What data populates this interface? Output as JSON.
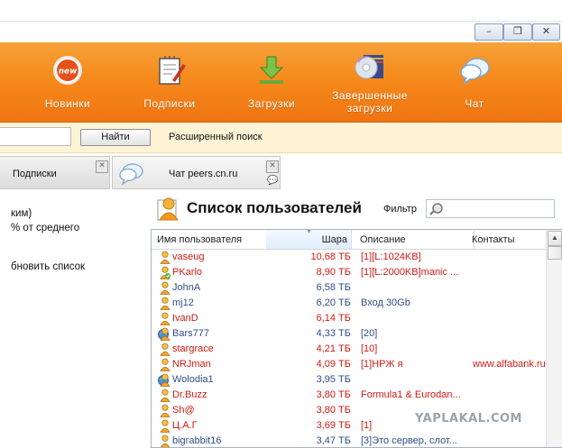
{
  "window": {
    "minimize": "–",
    "restore": "❐",
    "close": "✕"
  },
  "toolbar": {
    "items": [
      {
        "label": "Новинки",
        "icon": "new-badge-icon"
      },
      {
        "label": "Подписки",
        "icon": "subscriptions-notepad-icon"
      },
      {
        "label": "Загрузки",
        "icon": "download-arrow-icon"
      },
      {
        "label1": "Завершенные",
        "label2": "загрузки",
        "icon": "completed-downloads-disc-icon"
      },
      {
        "label": "Чат",
        "icon": "chat-bubbles-icon"
      }
    ],
    "colors": {
      "top": "#f7a23a",
      "bottom": "#ef7412"
    }
  },
  "search": {
    "value": "",
    "button": "Найти",
    "advanced": "Расширенный поиск"
  },
  "tabs": [
    {
      "label": "Подписки"
    },
    {
      "label": "Чат peers.cn.ru"
    }
  ],
  "left": {
    "line1": "ким)",
    "line2": "% от среднего",
    "line3": "бновить список"
  },
  "userlist": {
    "title": "Список пользователей",
    "filter_label": "Фильтр",
    "filter_value": "",
    "columns": [
      "Имя пользователя",
      "Шара",
      "Описание",
      "Контакты"
    ],
    "rows": [
      {
        "name": "vaseug",
        "share": "10,68 ТБ",
        "desc": "[1][L:1024KB]",
        "contact": "",
        "color": "red",
        "icon": "user-icon"
      },
      {
        "name": "PKarlo",
        "share": "8,90 ТБ",
        "desc": "[1][L:2000KB]manic ...",
        "contact": "",
        "color": "red",
        "icon": "user-ok-icon"
      },
      {
        "name": "JohnA",
        "share": "6,58 ТБ",
        "desc": "",
        "contact": "",
        "color": "blue",
        "icon": "user-icon"
      },
      {
        "name": "mj12",
        "share": "6,20 ТБ",
        "desc": "Вход 30Gb",
        "contact": "",
        "color": "blue",
        "icon": "user-icon"
      },
      {
        "name": "IvanD",
        "share": "6,14 ТБ",
        "desc": "",
        "contact": "",
        "color": "red",
        "icon": "user-icon"
      },
      {
        "name": "Bars777",
        "share": "4,33 ТБ",
        "desc": "[20]",
        "contact": "",
        "color": "blue",
        "icon": "user-globe-icon"
      },
      {
        "name": "stargrace",
        "share": "4,21 ТБ",
        "desc": "[10]",
        "contact": "",
        "color": "red",
        "icon": "user-icon"
      },
      {
        "name": "NRJman",
        "share": "4,09 ТБ",
        "desc": "[1]НРЖ я",
        "contact": "www.alfabank.ru",
        "color": "red",
        "icon": "user-icon"
      },
      {
        "name": "Wolodia1",
        "share": "3,95 ТБ",
        "desc": "",
        "contact": "",
        "color": "blue",
        "icon": "user-globe-icon"
      },
      {
        "name": "Dr.Buzz",
        "share": "3,80 ТБ",
        "desc": "Formula1 & Eurodan...",
        "contact": "",
        "color": "red",
        "icon": "user-icon"
      },
      {
        "name": "Sh@",
        "share": "3,80 ТБ",
        "desc": "",
        "contact": "",
        "color": "red",
        "icon": "user-icon"
      },
      {
        "name": "Ц.А.Г",
        "share": "3,69 ТБ",
        "desc": "[1]",
        "contact": "",
        "color": "red",
        "icon": "user-icon"
      },
      {
        "name": "bigrabbit16",
        "share": "3,47 ТБ",
        "desc": "[3]Это сервер, слот...",
        "contact": "",
        "color": "blue",
        "icon": "user-icon"
      }
    ]
  },
  "watermark": "YAPLAKAL.COM"
}
